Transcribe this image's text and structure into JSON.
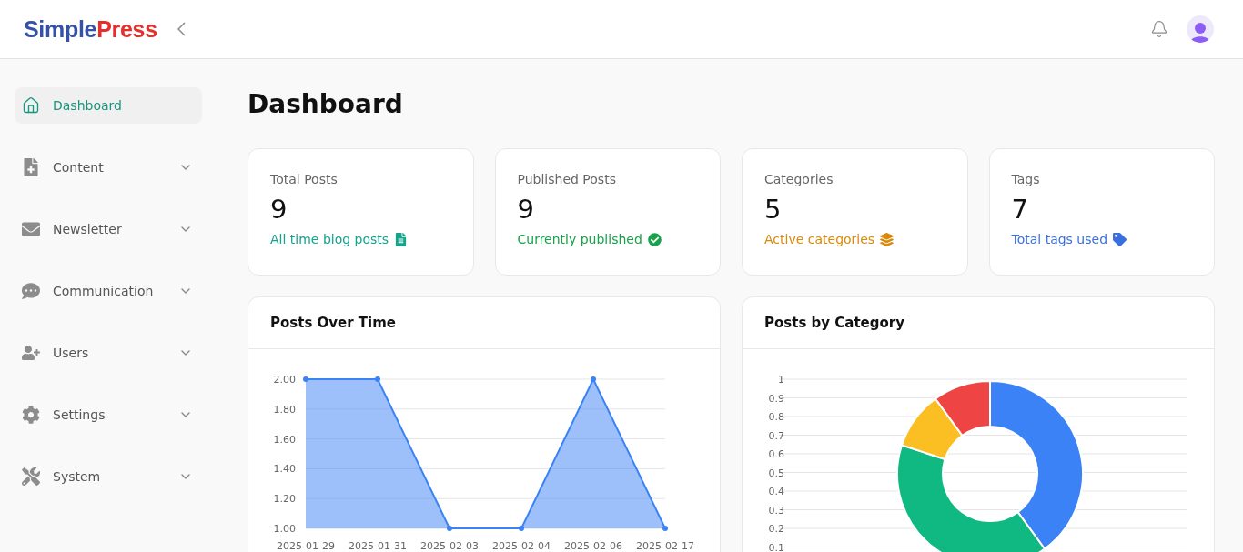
{
  "header": {
    "logo_parts": [
      "Simple",
      "Press"
    ]
  },
  "sidebar": {
    "items": [
      {
        "label": "Dashboard",
        "selected": true,
        "expandable": false
      },
      {
        "label": "Content",
        "selected": false,
        "expandable": true
      },
      {
        "label": "Newsletter",
        "selected": false,
        "expandable": true
      },
      {
        "label": "Communication",
        "selected": false,
        "expandable": true
      },
      {
        "label": "Users",
        "selected": false,
        "expandable": true
      },
      {
        "label": "Settings",
        "selected": false,
        "expandable": true
      },
      {
        "label": "System",
        "selected": false,
        "expandable": true
      }
    ]
  },
  "page": {
    "title": "Dashboard"
  },
  "stats": [
    {
      "label": "Total Posts",
      "value": "9",
      "note": "All time blog posts",
      "color": "#14a38b"
    },
    {
      "label": "Published Posts",
      "value": "9",
      "note": "Currently published",
      "color": "#16a34a"
    },
    {
      "label": "Categories",
      "value": "5",
      "note": "Active categories",
      "color": "#d98a0b"
    },
    {
      "label": "Tags",
      "value": "7",
      "note": "Total tags used",
      "color": "#3b6fe0"
    }
  ],
  "posts_over_time": {
    "title": "Posts Over Time",
    "chart_data": {
      "type": "area",
      "grid": true,
      "categories": [
        "2025-01-29",
        "2025-01-31",
        "2025-02-03",
        "2025-02-04",
        "2025-02-06",
        "2025-02-17"
      ],
      "series": [
        {
          "color": "#3b82f6",
          "values": [
            2,
            2,
            1,
            1,
            2,
            1
          ]
        }
      ],
      "ylim": [
        1,
        2
      ],
      "yticks": [
        {
          "value": 1,
          "label": "1.00"
        },
        {
          "value": 1.2,
          "label": "1.20"
        },
        {
          "value": 1.4,
          "label": "1.40"
        },
        {
          "value": 1.6,
          "label": "1.60"
        },
        {
          "value": 1.8,
          "label": "1.80"
        },
        {
          "value": 2,
          "label": "2.00"
        }
      ]
    }
  },
  "posts_by_category": {
    "title": "Posts by Category",
    "axis_labels": [
      "1",
      "0.9",
      "0.8",
      "0.7",
      "0.6",
      "0.5",
      "0.4",
      "0.3",
      "0.2",
      "0.1"
    ]
  }
}
